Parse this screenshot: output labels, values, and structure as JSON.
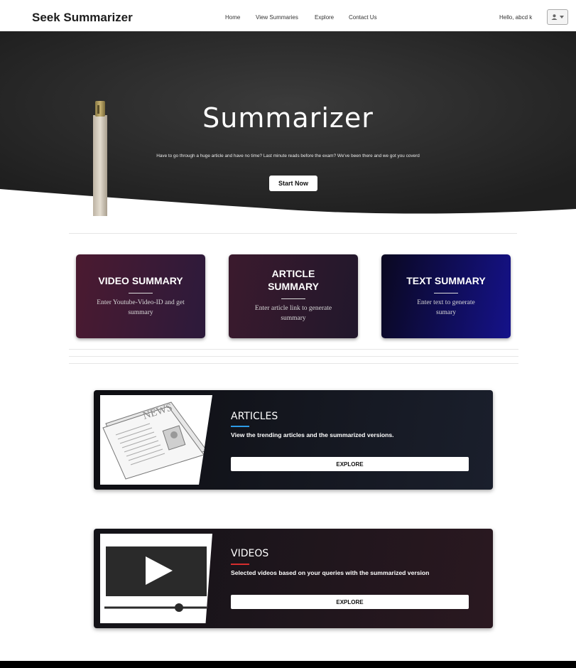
{
  "navbar": {
    "brand": "Seek Summarizer",
    "links": [
      "Home",
      "View Summaries",
      "Explore",
      "Contact Us"
    ],
    "greeting": "Hello, abcd k",
    "user_menu_icon": "user-icon"
  },
  "hero": {
    "title": "Summarizer",
    "subtitle": "Have to go through a huge article and have no time? Last minute reads before the exam? We've been there and we got you coverd",
    "cta_label": "Start Now"
  },
  "cards": [
    {
      "title": "VIDEO SUMMARY",
      "description": "Enter Youtube-Video-ID and get summary",
      "color_from": "#4a1a2f",
      "color_to": "#2d1a3a"
    },
    {
      "title": "ARTICLE SUMMARY",
      "description": "Enter article link to generate summary",
      "color_from": "#3b1a2c",
      "color_to": "#22182e"
    },
    {
      "title": "TEXT SUMMARY",
      "description": "Enter text to generate sumary",
      "color_from": "#0b0820",
      "color_to": "#15148a"
    }
  ],
  "panels": [
    {
      "title": "ARTICLES",
      "description": "View the trending articles and the summarized versions.",
      "button": "EXPLORE",
      "accent": "#2e9be6",
      "image_icon": "newspaper-icon"
    },
    {
      "title": "VIDEOS",
      "description": "Selected videos based on your queries with the summarized version",
      "button": "EXPLORE",
      "accent": "#d62d2d",
      "image_icon": "video-player-icon"
    }
  ]
}
